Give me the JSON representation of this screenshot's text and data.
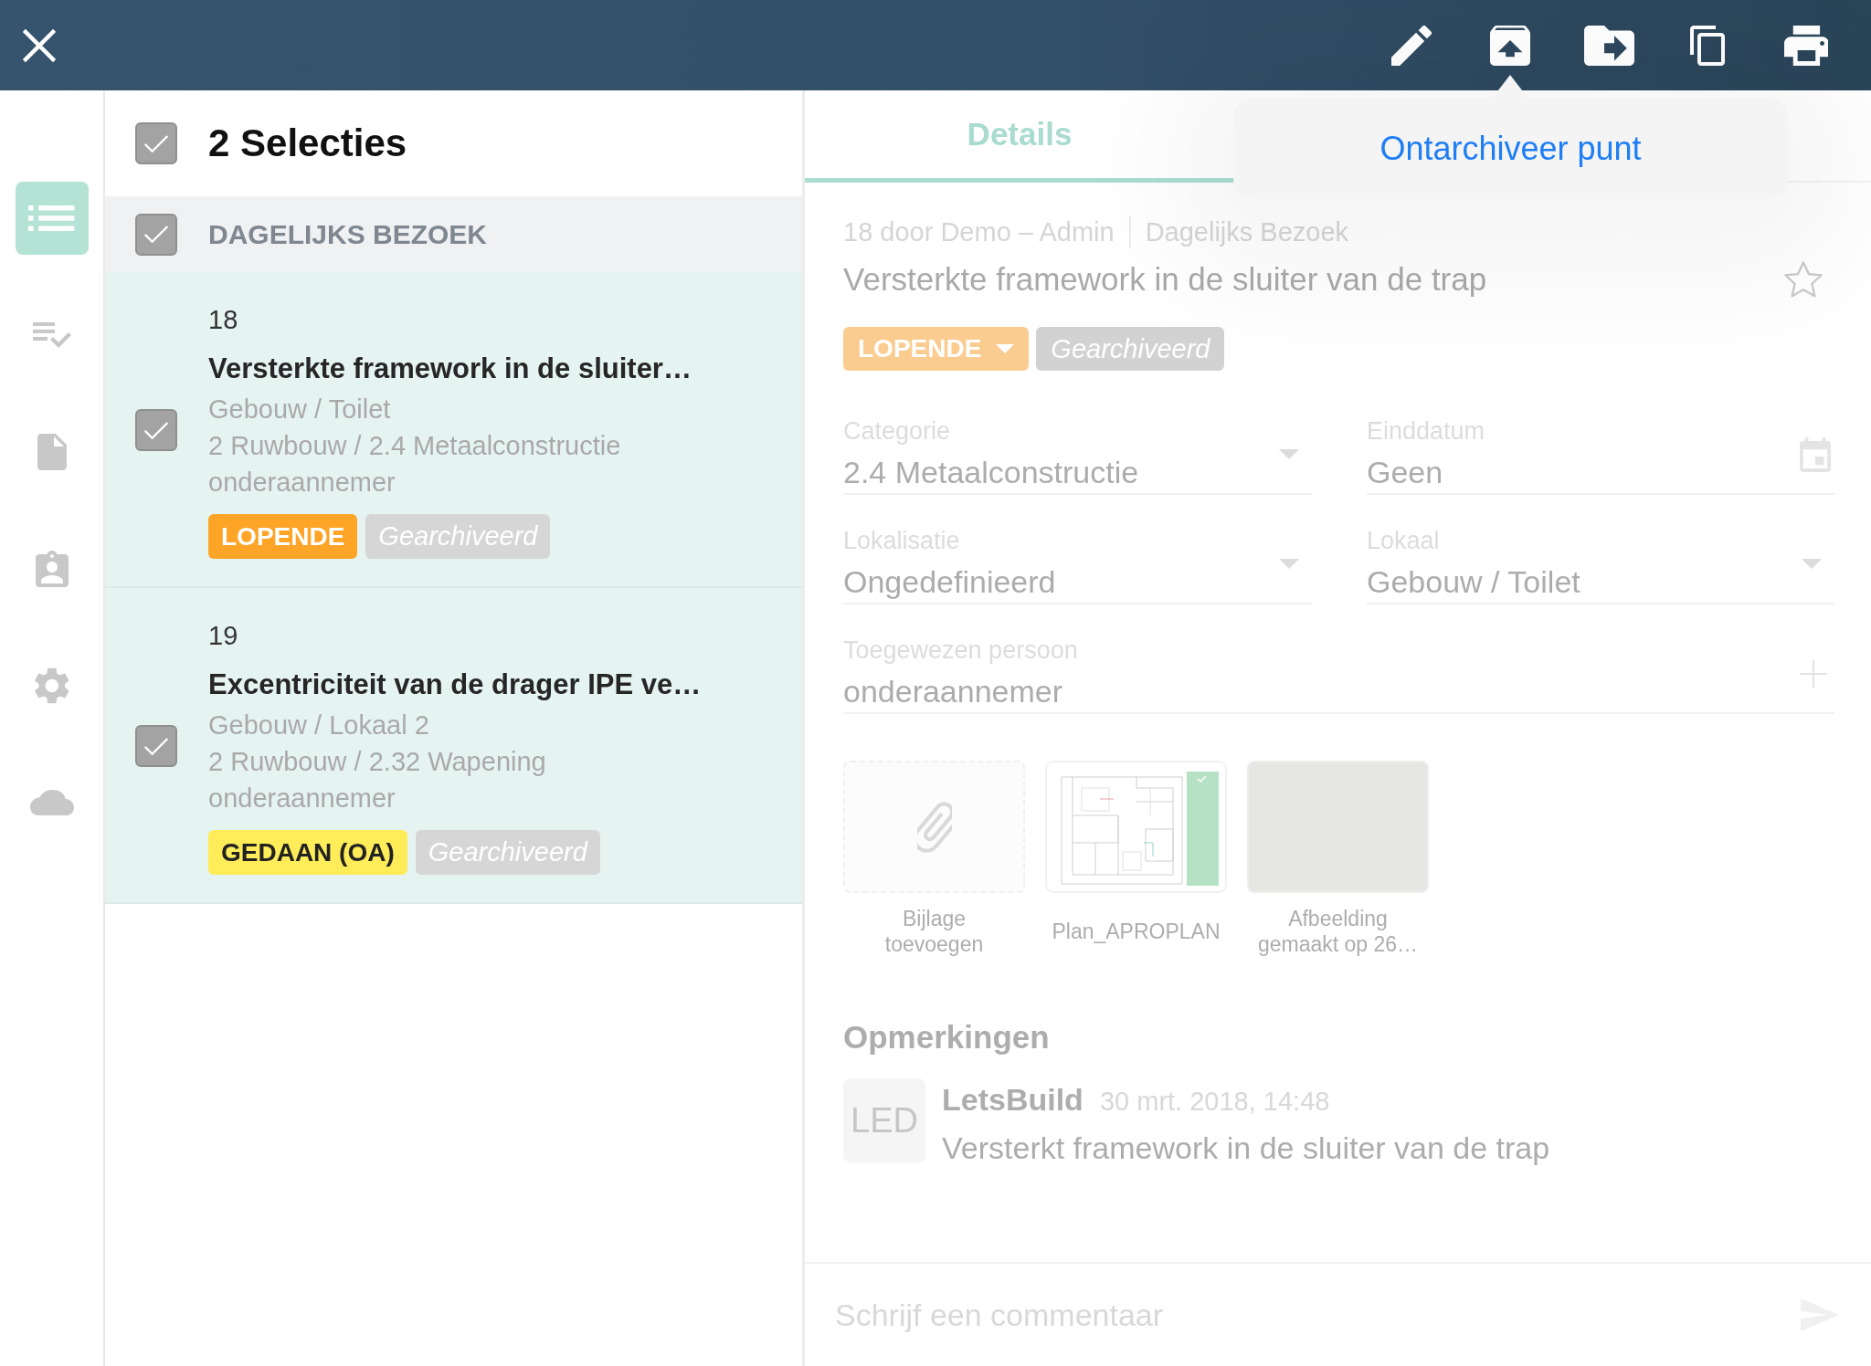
{
  "popover": {
    "item": "Ontarchiveer punt"
  },
  "nav": [
    {
      "selected": true
    },
    {
      "selected": false
    },
    {
      "selected": false
    },
    {
      "selected": false
    },
    {
      "selected": false
    },
    {
      "selected": false
    }
  ],
  "selection": {
    "title": "2 Selecties",
    "checked": true
  },
  "groups": [
    {
      "title": "DAGELIJKS BEZOEK",
      "checked": true,
      "items": [
        {
          "number": "18",
          "title": "Versterkte framework in de sluiter…",
          "location": "Gebouw / Toilet",
          "category": "2 Ruwbouw / 2.4 Metaalconstructie",
          "assignee": "onderaannemer",
          "checked": true,
          "tags": [
            {
              "kind": "status",
              "label": "LOPENDE",
              "color": "#fea427"
            },
            {
              "kind": "archived",
              "label": "Gearchiveerd",
              "color": "#d6d6d6"
            }
          ]
        },
        {
          "number": "19",
          "title": "Excentriciteit van de drager IPE ve…",
          "location": "Gebouw / Lokaal 2",
          "category": "2 Ruwbouw / 2.32 Wapening",
          "assignee": "onderaannemer",
          "checked": true,
          "tags": [
            {
              "kind": "status",
              "label": "GEDAAN (OA)",
              "color": "#feec58"
            },
            {
              "kind": "archived",
              "label": "Gearchiveerd",
              "color": "#d6d6d6"
            }
          ]
        }
      ]
    }
  ],
  "detail": {
    "tabs": [
      {
        "label": "Details",
        "selected": true
      }
    ],
    "meta": [
      "18 door Demo – Admin",
      "Dagelijks Bezoek"
    ],
    "title": "Versterkte framework in de sluiter van de trap",
    "starred": false,
    "tags": [
      {
        "kind": "status",
        "label": "LOPENDE",
        "color": "#facc8f"
      },
      {
        "kind": "archived",
        "label": "Gearchiveerd",
        "color": "#d2d2d2"
      }
    ],
    "fields": [
      {
        "kind": "dropdown",
        "label": "Categorie",
        "value": "2.4 Metaalconstructie"
      },
      {
        "kind": "date",
        "label": "Einddatum",
        "value": "Geen"
      },
      {
        "kind": "dropdown",
        "label": "Lokalisatie",
        "value": "Ongedefinieerd"
      },
      {
        "kind": "dropdown",
        "label": "Lokaal",
        "value": "Gebouw / Toilet"
      },
      {
        "kind": "person",
        "label": "Toegewezen persoon",
        "value": "onderaannemer"
      }
    ],
    "attachments": [
      {
        "kind": "add",
        "caption": "Bijlage toevoegen"
      },
      {
        "kind": "plan",
        "caption": "Plan_APROPLAN"
      },
      {
        "kind": "photo",
        "caption": "Afbeelding gemaakt op 26…"
      }
    ],
    "comments_title": "Opmerkingen",
    "comments": [
      {
        "avatar": "LED",
        "author": "LetsBuild",
        "time": "30 mrt. 2018, 14:48",
        "text": "Versterkt framework in de sluiter van de trap"
      }
    ],
    "comment_input": {
      "placeholder": "Schrijf een commentaar"
    }
  }
}
